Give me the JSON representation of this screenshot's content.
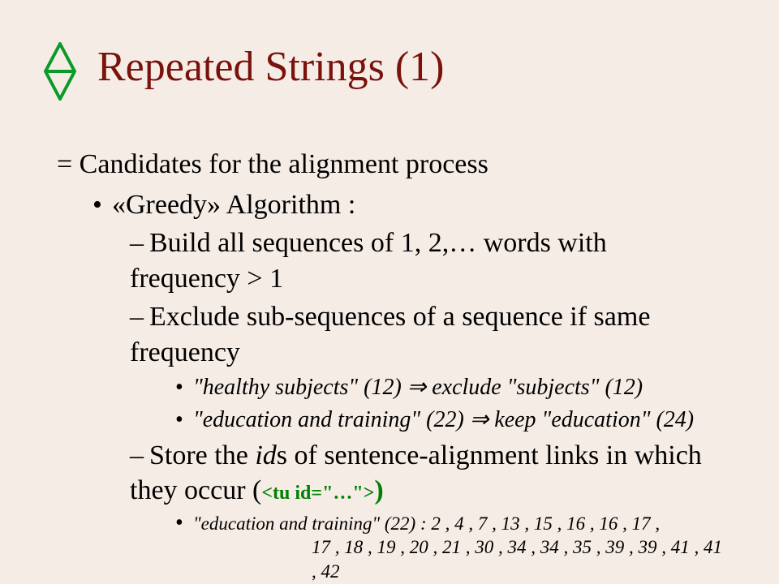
{
  "title": "Repeated Strings (1)",
  "lines": {
    "candidates": "= Candidates for the alignment process",
    "greedy": "«Greedy» Algorithm :",
    "build": "Build all sequences of 1, 2,… words with frequency > 1",
    "exclude": "Exclude sub-sequences of a sequence if same frequency",
    "healthy": "\"healthy subjects\" (12) ⇒ exclude \"subjects\" (12)",
    "edu_keep": "\"education and training\" (22) ⇒ keep \"education\" (24)",
    "store_a": "Store the ",
    "store_ids": "id",
    "store_b": "s of sentence-alignment links in which they occur (",
    "tuid": "<tu id=\"…\">",
    "store_close": ")",
    "example_a": "\"education and training\" (22) : 2 , 4 , 7 , 13 , 15 , 16 , 16 , 17 ,",
    "example_b": "17 , 18 , 19 , 20 , 21 , 30 , 34 , 34 , 35 , 39 , 39 , 41 , 41 , 42"
  },
  "bullets": {
    "dot": "•",
    "dash": "–"
  }
}
